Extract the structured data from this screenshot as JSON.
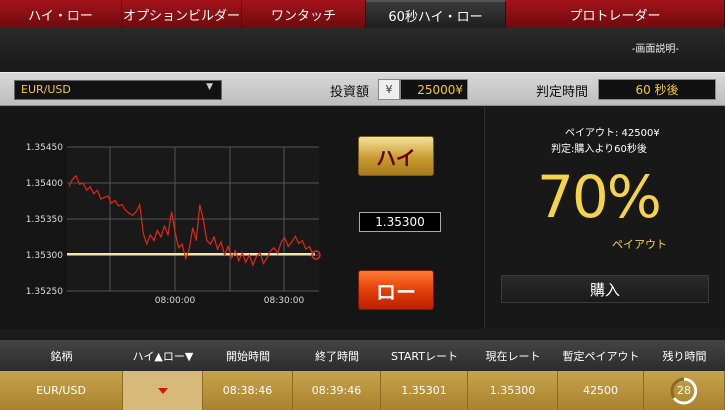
{
  "tabs": [
    {
      "label": "ハイ・ロー",
      "active": false
    },
    {
      "label": "オプションビルダー",
      "active": false
    },
    {
      "label": "ワンタッチ",
      "active": false
    },
    {
      "label": "60秒ハイ・ロー",
      "active": true
    },
    {
      "label": "プロトレーダー",
      "active": false
    }
  ],
  "help_link": "-画面説明-",
  "controls": {
    "pair": "EUR/USD",
    "invest_label": "投資額",
    "currency_symbol": "¥",
    "invest_value": "25000¥",
    "judge_label": "判定時間",
    "judge_value": "60 秒後"
  },
  "trade": {
    "high_label": "ハイ",
    "low_label": "ロー",
    "current_rate": "1.35300"
  },
  "payout": {
    "payout_line": "ペイアウト: 42500¥",
    "judge_line": "判定:購入より60秒後",
    "percent": "70%",
    "percent_label": "ペイアウト",
    "buy_label": "購入"
  },
  "table": {
    "headers": [
      "銘柄",
      "ハイ▲ロー▼",
      "開始時間",
      "終了時間",
      "STARTレート",
      "現在レート",
      "暫定ペイアウト",
      "残り時間"
    ],
    "row": {
      "pair": "EUR/USD",
      "direction": "down",
      "start_time": "08:38:46",
      "end_time": "08:39:46",
      "start_rate": "1.35301",
      "current_rate": "1.35300",
      "payout": "42500",
      "remaining": "28"
    }
  },
  "colors": {
    "tab_red": "#a3141a",
    "accent_gold": "#f5d34a",
    "line_red": "#e0281a",
    "start_line": "#f2e6a8"
  },
  "chart_data": {
    "type": "line",
    "y_ticks": [
      "1.35450",
      "1.35400",
      "1.35350",
      "1.35300",
      "1.35250"
    ],
    "x_ticks": [
      "08:00:00",
      "08:30:00"
    ],
    "ylim": [
      1.3525,
      1.3546
    ],
    "start_rate": 1.35301,
    "current_rate": 1.353,
    "series": [
      {
        "values": [
          1.35395,
          1.35405,
          1.3541,
          1.35398,
          1.354,
          1.3539,
          1.35395,
          1.35385,
          1.3539,
          1.35378,
          1.3538,
          1.35382,
          1.35372,
          1.35376,
          1.35368,
          1.3537,
          1.35362,
          1.35358,
          1.35355,
          1.3536,
          1.3537,
          1.3533,
          1.35315,
          1.35328,
          1.3532,
          1.35334,
          1.35325,
          1.3534,
          1.35328,
          1.3536,
          1.35332,
          1.3531,
          1.35315,
          1.35295,
          1.35308,
          1.35338,
          1.3532,
          1.3537,
          1.35348,
          1.3532,
          1.35315,
          1.35325,
          1.35308,
          1.35318,
          1.353,
          1.35312,
          1.35296,
          1.35306,
          1.35292,
          1.35303,
          1.3529,
          1.353,
          1.35286,
          1.35298,
          1.35303,
          1.35288,
          1.35296,
          1.35306,
          1.3531,
          1.35302,
          1.35318,
          1.35324,
          1.35312,
          1.35318,
          1.35326,
          1.35316,
          1.3532,
          1.35308,
          1.35312,
          1.353
        ]
      }
    ]
  }
}
